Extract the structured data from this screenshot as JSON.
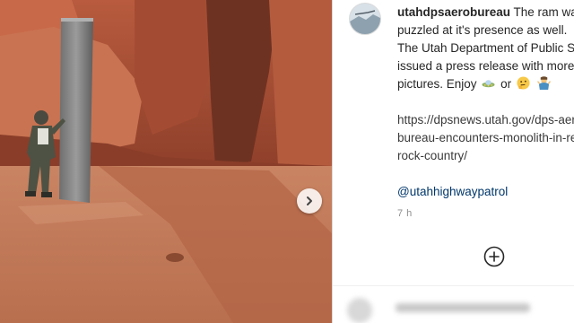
{
  "post": {
    "username": "utahdpsaerobureau",
    "caption_lines": [
      " The ram was",
      "puzzled at it's presence as well.",
      "The Utah Department of Public Safety",
      "issued a press release with more",
      "pictures. Enjoy"
    ],
    "emoji_separator": "or",
    "link_lines": [
      "https://dpsnews.utah.gov/dps-aero-",
      "bureau-encounters-monolith-in-red-",
      "rock-country/"
    ],
    "mention": "@utahhighwaypatrol",
    "timestamp": "7 h"
  },
  "icons": {
    "next": "chevron-right-icon",
    "add": "plus-circle-icon",
    "emoji_1": "ufo-emoji",
    "emoji_2": "thinking-face-emoji",
    "emoji_3": "person-shrugging-emoji"
  },
  "colors": {
    "text": "#262626",
    "mention": "#00376b",
    "muted": "#8e8e8e",
    "divider": "#dbdbdb"
  }
}
